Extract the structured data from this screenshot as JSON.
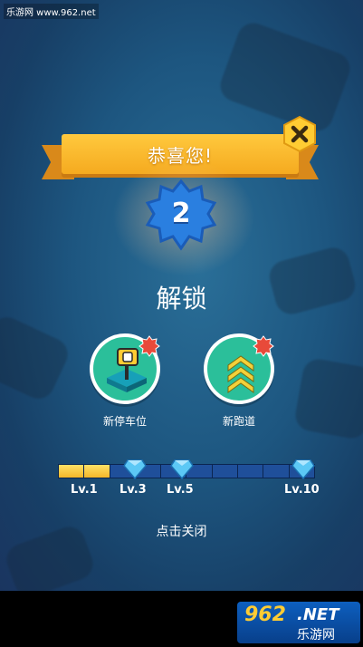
{
  "watermark": "乐游网 www.962.net",
  "banner": {
    "title": "恭喜您!"
  },
  "level": {
    "value": "2"
  },
  "unlock": {
    "title": "解锁"
  },
  "rewards": [
    {
      "label": "新停车位",
      "icon": "parking-sign-icon"
    },
    {
      "label": "新跑道",
      "icon": "chevron-up-track-icon"
    }
  ],
  "progress": {
    "segments": 10,
    "filled": 2,
    "labels": [
      "Lv.1",
      "Lv.3",
      "Lv.5",
      "Lv.10"
    ]
  },
  "tap_close": "点击关闭",
  "logo": {
    "main": "962",
    "net": ".NET",
    "sub": "乐游网"
  },
  "colors": {
    "ribbon": "#f5aa1f",
    "badge": "#2a7fe0",
    "reward_circle": "#2bbf9a",
    "progress_filled": "#f3b62a",
    "progress_empty": "#1f4f9a"
  }
}
